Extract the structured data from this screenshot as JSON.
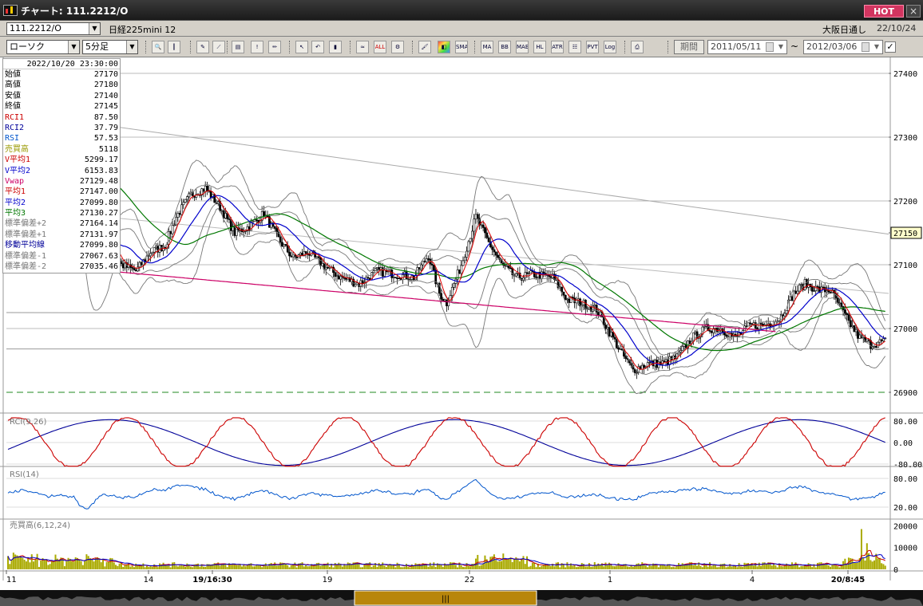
{
  "window": {
    "title": "チャート: 111.2212/O",
    "hot_label": "HOT",
    "close_label": "×"
  },
  "infobar": {
    "code": "111.2212/O",
    "instrument": "日経225mini 12",
    "market": "大阪日通し",
    "date": "22/10/24"
  },
  "toolbar": {
    "chart_type": "ローソク",
    "timeframe": "5分足",
    "icons": [
      "zoom-icon",
      "cursor-icon",
      "draw-icon",
      "trend-icon",
      "memo-icon",
      "alert-icon",
      "pen-icon",
      "select-icon",
      "undo-icon",
      "candle-icon",
      "wave-icon",
      "all-icon",
      "settings-icon",
      "brush-icon",
      "palette-icon",
      "sma-icon",
      "ma-icon",
      "bb-icon",
      "mae-icon",
      "hl-icon",
      "atr-icon",
      "param-icon",
      "pvt-icon",
      "log-icon",
      "export-icon"
    ],
    "icon_labels": {
      "all": "ALL",
      "sma": "SMA",
      "ma": "MA",
      "bb": "BB",
      "mae": "MAE",
      "hl": "HL",
      "atr": "ATR",
      "pvt": "PVT",
      "log": "Log"
    },
    "period_label": "期間",
    "date_from": "2011/05/11",
    "date_to": "2012/03/06",
    "tilde": "~",
    "check": "✓"
  },
  "data_panel": {
    "timestamp": "2022/10/20  23:30:00",
    "rows": [
      {
        "label": "始値",
        "value": "27170",
        "color": "#000000"
      },
      {
        "label": "高値",
        "value": "27180",
        "color": "#000000"
      },
      {
        "label": "安値",
        "value": "27140",
        "color": "#000000"
      },
      {
        "label": "終値",
        "value": "27145",
        "color": "#000000"
      },
      {
        "label": "RCI1",
        "value": "87.50",
        "color": "#cc0000"
      },
      {
        "label": "RCI2",
        "value": "37.79",
        "color": "#000099"
      },
      {
        "label": "RSI",
        "value": "57.53",
        "color": "#0055cc"
      },
      {
        "label": "売買高",
        "value": "5118",
        "color": "#999900"
      },
      {
        "label": "V平均1",
        "value": "5299.17",
        "color": "#cc0000"
      },
      {
        "label": "V平均2",
        "value": "6153.83",
        "color": "#0000cc"
      },
      {
        "label": "Vwap",
        "value": "27129.48",
        "color": "#cc0066"
      },
      {
        "label": "平均1",
        "value": "27147.00",
        "color": "#cc0000"
      },
      {
        "label": "平均2",
        "value": "27099.80",
        "color": "#0000cc"
      },
      {
        "label": "平均3",
        "value": "27130.27",
        "color": "#007700"
      },
      {
        "label": "標準偏差+2",
        "value": "27164.14",
        "color": "#777777"
      },
      {
        "label": "標準偏差+1",
        "value": "27131.97",
        "color": "#777777"
      },
      {
        "label": "移動平均線",
        "value": "27099.80",
        "color": "#000099"
      },
      {
        "label": "標準偏差-1",
        "value": "27067.63",
        "color": "#777777"
      },
      {
        "label": "標準偏差-2",
        "value": "27035.46",
        "color": "#777777"
      }
    ]
  },
  "price_axis": {
    "ticks": [
      "27400",
      "27300",
      "27200",
      "27150",
      "27100",
      "27000",
      "26900"
    ],
    "current": "27150"
  },
  "indicators": {
    "rci": {
      "title": "RCI(9,26)",
      "ticks": [
        "80.00",
        "0.00",
        "-80.00"
      ]
    },
    "rsi": {
      "title": "RSI(14)",
      "ticks": [
        "80.00",
        "20.00"
      ]
    },
    "volume": {
      "title": "売買高(6,12,24)",
      "ticks": [
        "20000",
        "10000",
        "0"
      ]
    }
  },
  "x_axis": {
    "labels": [
      "11",
      "14",
      "19/16:30",
      "19",
      "22",
      "1",
      "4",
      "20/8:45"
    ]
  },
  "colors": {
    "candle_up": "#ffffff",
    "candle_down": "#000000",
    "ma1": "#dd0000",
    "ma2": "#0000cc",
    "ma3": "#007700",
    "vwap": "#cc0066",
    "bands": "#777777",
    "volume": "#aaaa00",
    "scroll_thumb": "#b8860b"
  }
}
